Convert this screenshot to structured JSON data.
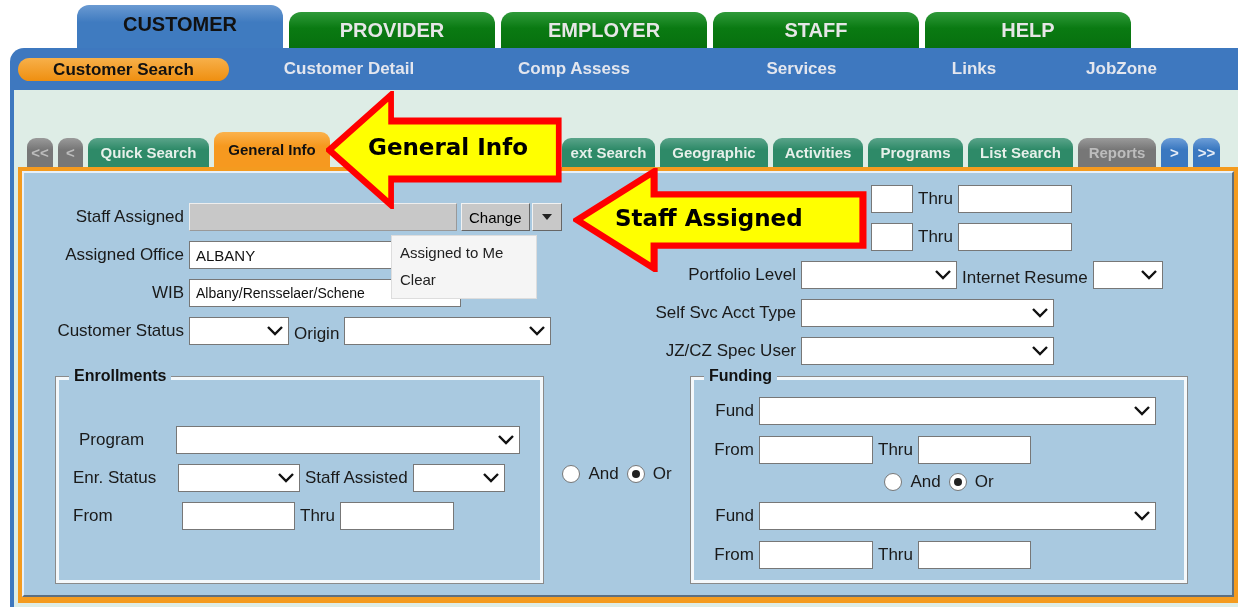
{
  "main_tabs": [
    {
      "label": "CUSTOMER",
      "selected": true
    },
    {
      "label": "PROVIDER",
      "selected": false
    },
    {
      "label": "EMPLOYER",
      "selected": false
    },
    {
      "label": "STAFF",
      "selected": false
    },
    {
      "label": "HELP",
      "selected": false
    }
  ],
  "sub_nav": [
    {
      "label": "Customer Search",
      "selected": true
    },
    {
      "label": "Customer Detail",
      "selected": false
    },
    {
      "label": "Comp Assess",
      "selected": false
    },
    {
      "label": "Services",
      "selected": false
    },
    {
      "label": "Links",
      "selected": false
    },
    {
      "label": "JobZone",
      "selected": false
    }
  ],
  "section_tabs": [
    {
      "label": "<<",
      "kind": "nav",
      "selected": false,
      "disabled": true
    },
    {
      "label": "<",
      "kind": "nav",
      "selected": false,
      "disabled": true
    },
    {
      "label": "Quick Search",
      "kind": "page",
      "selected": false,
      "disabled": false
    },
    {
      "label": "General Info",
      "kind": "page",
      "selected": true,
      "disabled": false
    },
    {
      "label": "ext Search",
      "kind": "page",
      "selected": false,
      "disabled": false
    },
    {
      "label": "Geographic",
      "kind": "page",
      "selected": false,
      "disabled": false
    },
    {
      "label": "Activities",
      "kind": "page",
      "selected": false,
      "disabled": false
    },
    {
      "label": "Programs",
      "kind": "page",
      "selected": false,
      "disabled": false
    },
    {
      "label": "List Search",
      "kind": "page",
      "selected": false,
      "disabled": false
    },
    {
      "label": "Reports",
      "kind": "page",
      "selected": false,
      "disabled": true
    },
    {
      "label": ">",
      "kind": "nav",
      "selected": false,
      "disabled": false
    },
    {
      "label": ">>",
      "kind": "nav",
      "selected": false,
      "disabled": false
    }
  ],
  "form": {
    "staff_assigned": {
      "label": "Staff Assigned",
      "disabled": true,
      "button": "Change",
      "menu": [
        {
          "label": "Assigned to Me"
        },
        {
          "label": "Clear"
        }
      ]
    },
    "assigned_office": {
      "label": "Assigned Office",
      "value": "ALBANY"
    },
    "wib": {
      "label": "WIB",
      "value": "Albany/Rensselaer/Schene"
    },
    "customer_status": {
      "label": "Customer Status"
    },
    "origin": {
      "label": "Origin"
    },
    "date_ranges": [
      {
        "thru_label": "Thru"
      },
      {
        "thru_label": "Thru"
      }
    ],
    "portfolio_level": {
      "label": "Portfolio Level"
    },
    "internet_resume": {
      "label": "Internet Resume"
    },
    "self_svc_acct_type": {
      "label": "Self Svc Acct Type"
    },
    "jz_cz_spec_user": {
      "label": "JZ/CZ Spec User"
    },
    "enrollments": {
      "title": "Enrollments",
      "program_label": "Program",
      "enr_status_label": "Enr. Status",
      "staff_assisted_label": "Staff Assisted",
      "from_label": "From",
      "thru_label": "Thru"
    },
    "join": [
      {
        "label": "And",
        "selected": false
      },
      {
        "label": "Or",
        "selected": true
      }
    ],
    "funding": {
      "title": "Funding",
      "blocks": [
        {
          "fund_label": "Fund",
          "from_label": "From",
          "thru_label": "Thru"
        },
        {
          "fund_label": "Fund",
          "from_label": "From",
          "thru_label": "Thru"
        }
      ],
      "join": [
        {
          "label": "And",
          "selected": false
        },
        {
          "label": "Or",
          "selected": true
        }
      ]
    }
  },
  "callouts": [
    {
      "text": "General Info"
    },
    {
      "text": "Staff Assigned"
    }
  ]
}
